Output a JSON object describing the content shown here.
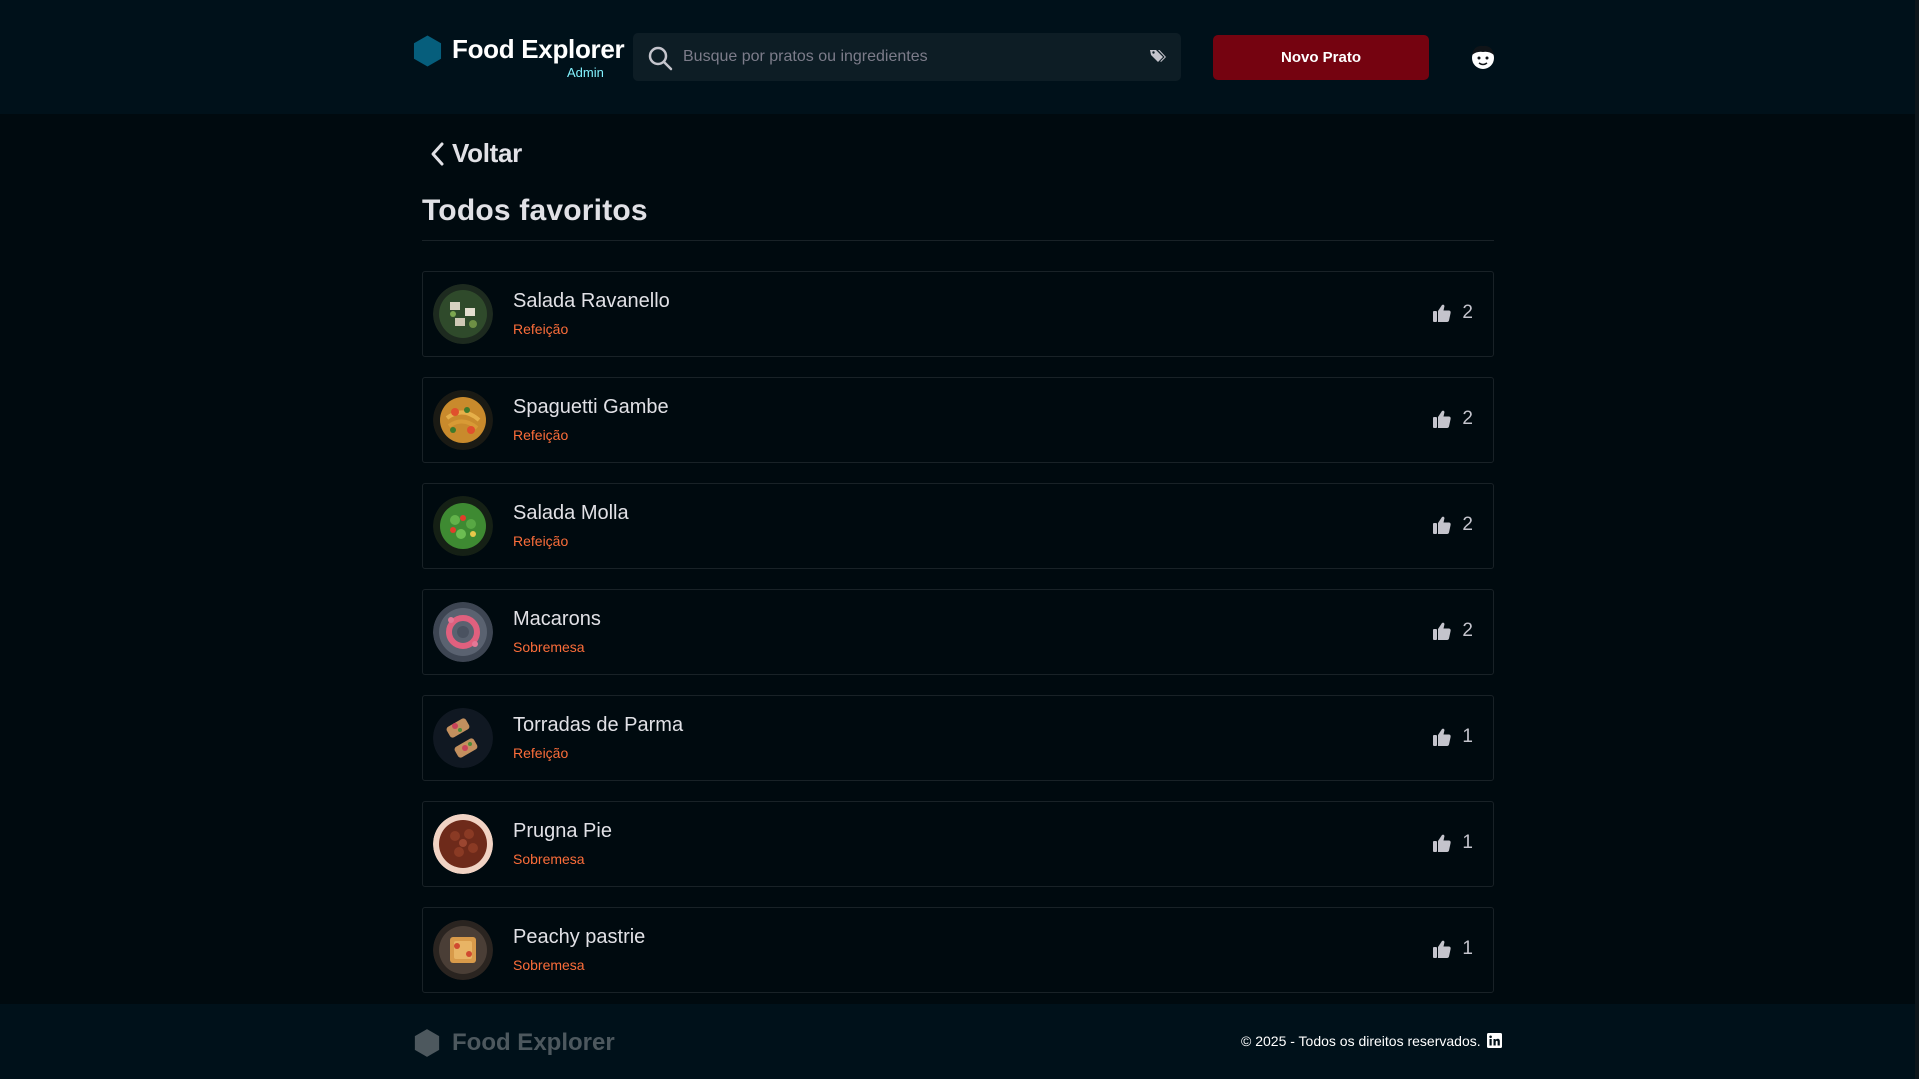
{
  "header": {
    "brand_name": "Food Explorer",
    "brand_role": "Admin",
    "search_placeholder": "Busque por pratos ou ingredientes",
    "new_dish_label": "Novo Prato"
  },
  "main": {
    "back_label": "Voltar",
    "title": "Todos favoritos",
    "items": [
      {
        "name": "Salada Ravanello",
        "category": "Refeição",
        "likes": "2"
      },
      {
        "name": "Spaguetti Gambe",
        "category": "Refeição",
        "likes": "2"
      },
      {
        "name": "Salada Molla",
        "category": "Refeição",
        "likes": "2"
      },
      {
        "name": "Macarons",
        "category": "Sobremesa",
        "likes": "2"
      },
      {
        "name": "Torradas de Parma",
        "category": "Refeição",
        "likes": "1"
      },
      {
        "name": "Prugna Pie",
        "category": "Sobremesa",
        "likes": "1"
      },
      {
        "name": "Peachy pastrie",
        "category": "Sobremesa",
        "likes": "1"
      }
    ]
  },
  "footer": {
    "brand_name": "Food Explorer",
    "copyright": "© 2025 - Todos os direitos reservados."
  },
  "icons": {
    "logo": "hexagon-icon",
    "search": "search-icon",
    "tags": "tag-icon",
    "avatar": "user-avatar-icon",
    "back": "chevron-left-icon",
    "like": "thumbs-up-icon",
    "social": "linkedin-icon"
  },
  "colors": {
    "background": "#000a0f",
    "header": "#00111a",
    "accent_button": "#750310",
    "category_text": "#fb6d3a",
    "admin_text": "#82f3ff",
    "logo": "#065e7c"
  }
}
